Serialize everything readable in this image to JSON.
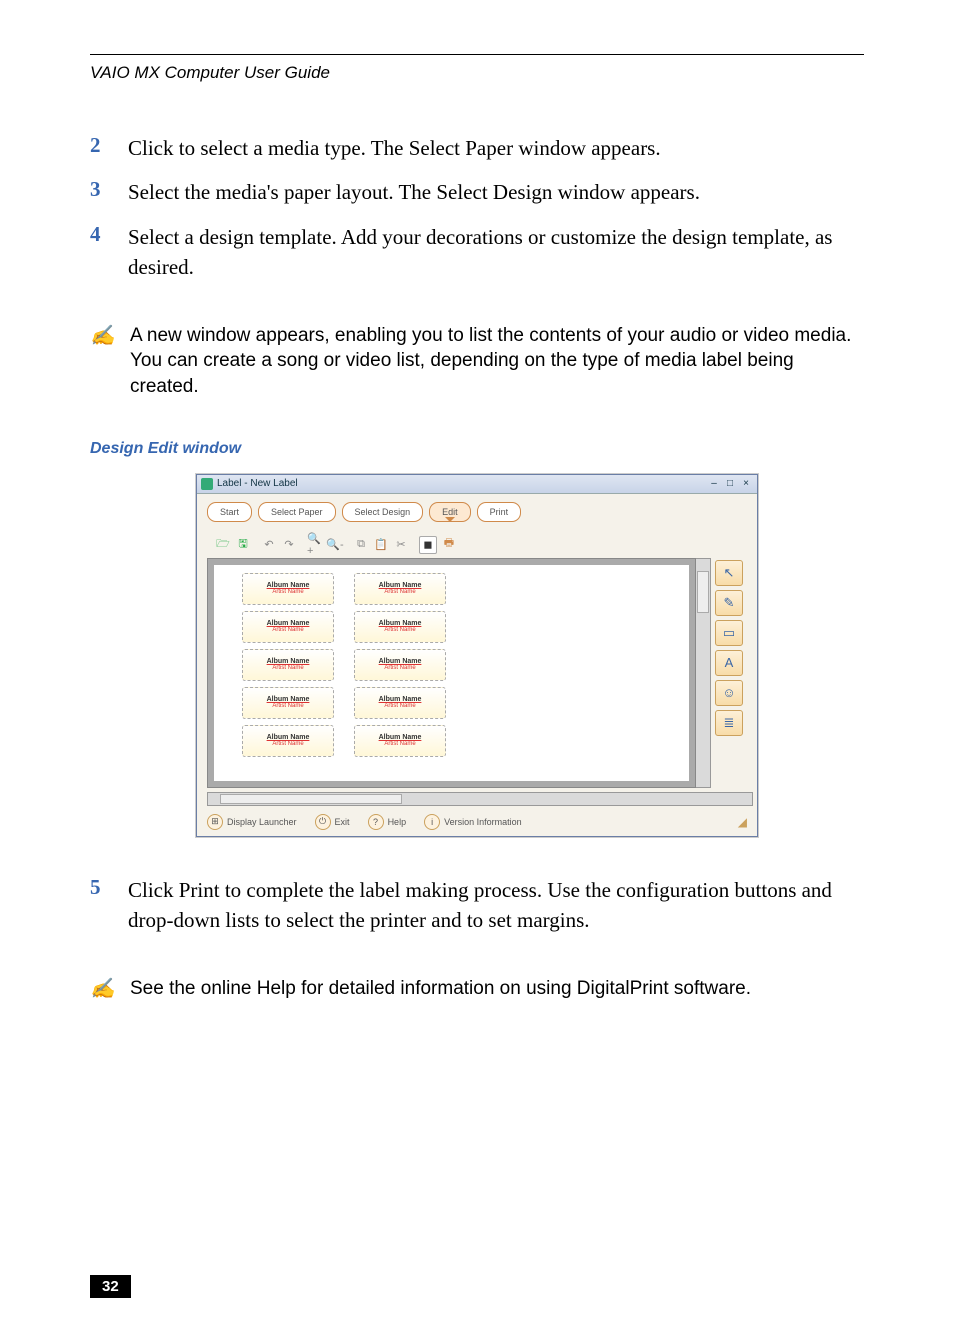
{
  "running_head": "VAIO MX Computer User Guide",
  "steps": [
    {
      "num": "2",
      "text": "Click to select a media type. The Select Paper window appears."
    },
    {
      "num": "3",
      "text": "Select the media's paper layout. The Select Design window appears."
    },
    {
      "num": "4",
      "text": "Select a design template. Add your decorations or customize the design template, as desired."
    }
  ],
  "note1": "A new window appears, enabling you to list the contents of your audio or video media. You can create a song or video list, depending on the type of media label being created.",
  "figure_caption": "Design Edit window",
  "win": {
    "title": "Label - New Label",
    "steps": [
      "Start",
      "Select Paper",
      "Select Design",
      "Edit",
      "Print"
    ],
    "active_step": "Edit",
    "label_title": "Album Name",
    "label_sub": "Artist Name",
    "rows": 5,
    "cols": 2,
    "footer": {
      "launcher": "Display Launcher",
      "exit": "Exit",
      "help": "Help",
      "version": "Version Information"
    }
  },
  "step5": {
    "num": "5",
    "text": "Click Print to complete the label making process. Use the configuration buttons and drop-down lists to select the printer and to set margins."
  },
  "note2": "See the online Help for detailed information on using DigitalPrint software.",
  "page_number": "32"
}
